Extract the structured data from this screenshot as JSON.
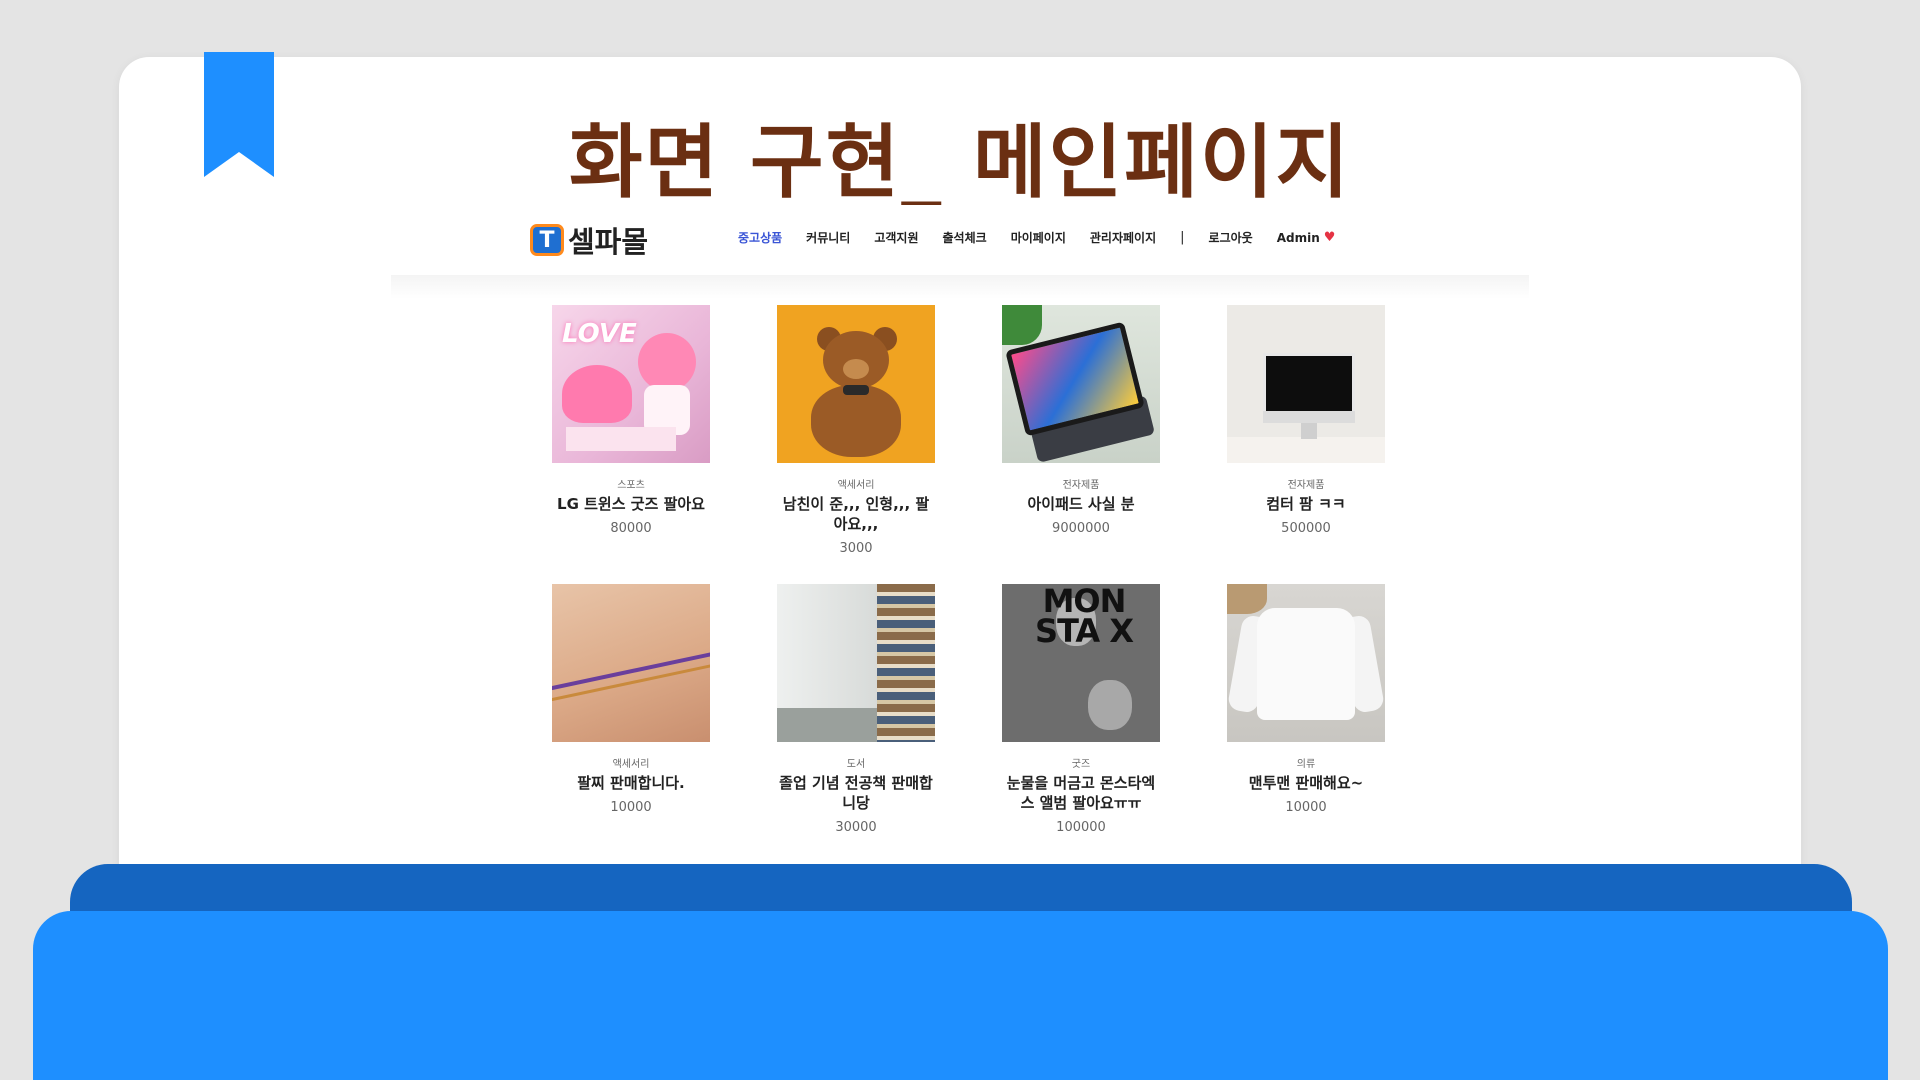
{
  "slide": {
    "title": "화면 구현_ 메인페이지"
  },
  "header": {
    "logo_mark": "T",
    "logo_text": "셀파몰",
    "nav": [
      "중고상품",
      "커뮤니티",
      "고객지원",
      "출석체크",
      "마이페이지",
      "관리자페이지"
    ],
    "separator": "|",
    "logout": "로그아웃",
    "admin": "Admin",
    "heart_icon": "♥"
  },
  "products": [
    {
      "category": "스포츠",
      "title": "LG 트윈스 굿즈 팔아요",
      "price": "80000"
    },
    {
      "category": "액세서리",
      "title": "남친이 준,,, 인형,,, 팔아요,,,",
      "price": "3000"
    },
    {
      "category": "전자제품",
      "title": "아이패드 사실 분",
      "price": "9000000"
    },
    {
      "category": "전자제품",
      "title": "컴터 팜 ㅋㅋ",
      "price": "500000"
    },
    {
      "category": "액세서리",
      "title": "팔찌 판매합니다.",
      "price": "10000"
    },
    {
      "category": "도서",
      "title": "졸업 기념 전공책 판매합니당",
      "price": "30000"
    },
    {
      "category": "굿즈",
      "title": "눈물을 머금고 몬스타엑스 앨범 팔아요ㅠㅠ",
      "price": "100000"
    },
    {
      "category": "의류",
      "title": "맨투맨 판매해요~",
      "price": "10000"
    }
  ],
  "images": {
    "love_text": "LOVE",
    "album_text": "MON STA X"
  },
  "colors": {
    "accent_blue": "#1e8fff",
    "title_brown": "#6b2f12",
    "nav_active": "#3a55d6"
  }
}
